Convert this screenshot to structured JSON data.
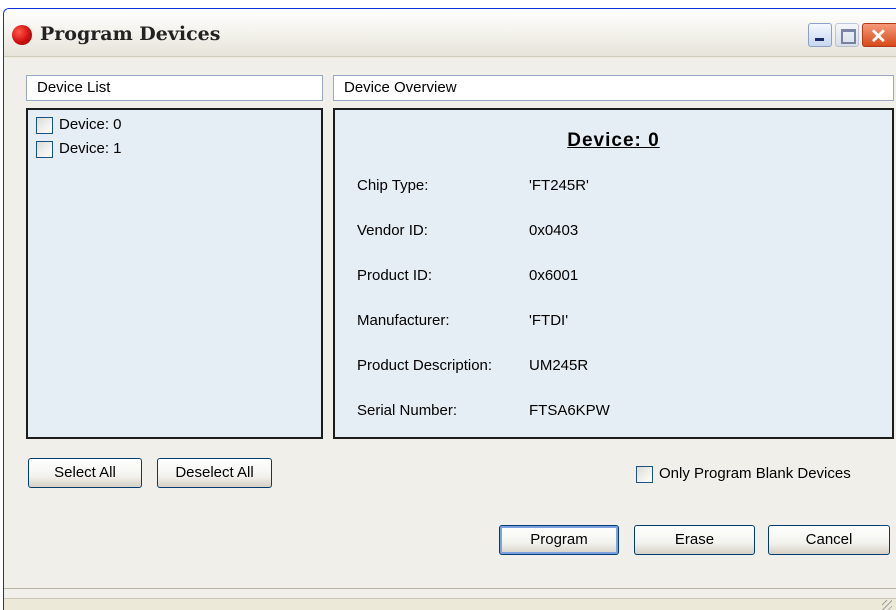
{
  "window": {
    "title": "Program Devices"
  },
  "device_list": {
    "header": "Device List",
    "items": [
      {
        "label": "Device: 0",
        "checked": false
      },
      {
        "label": "Device: 1",
        "checked": false
      }
    ],
    "select_all": "Select All",
    "deselect_all": "Deselect All"
  },
  "overview": {
    "header": "Device Overview",
    "title": "Device: 0",
    "rows": [
      {
        "label": "Chip Type:",
        "value": "'FT245R'"
      },
      {
        "label": "Vendor ID:",
        "value": "0x0403"
      },
      {
        "label": "Product ID:",
        "value": "0x6001"
      },
      {
        "label": "Manufacturer:",
        "value": "'FTDI'"
      },
      {
        "label": "Product Description:",
        "value": "UM245R"
      },
      {
        "label": "Serial Number:",
        "value": "FTSA6KPW"
      }
    ]
  },
  "options": {
    "only_blank_label": "Only Program Blank Devices",
    "only_blank_checked": false
  },
  "actions": {
    "program": "Program",
    "erase": "Erase",
    "cancel": "Cancel"
  },
  "colors": {
    "titlebar_close": "#d64a1a",
    "panel_fill": "#e6eef5",
    "accent_border": "#0831d9"
  }
}
